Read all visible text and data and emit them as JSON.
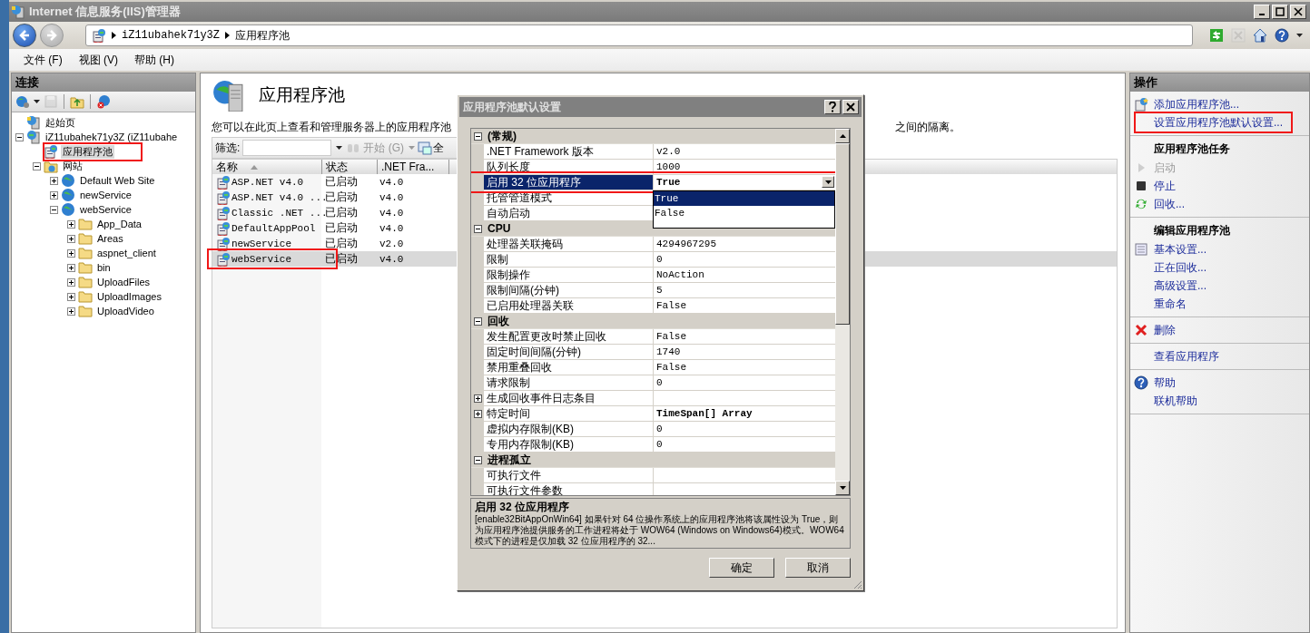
{
  "window": {
    "title": "Internet 信息服务(IIS)管理器"
  },
  "address_bar": {
    "back_enabled": true,
    "forward_enabled": false,
    "crumbs": [
      "iZ11ubahek71y3Z",
      "应用程序池"
    ]
  },
  "toolbar": [
    {
      "kind": "refresh",
      "disabled": false
    },
    {
      "kind": "stop",
      "disabled": true
    },
    {
      "kind": "home",
      "disabled": false
    },
    {
      "kind": "help",
      "disabled": false
    }
  ],
  "menu": [
    "文件 (F)",
    "视图 (V)",
    "帮助 (H)"
  ],
  "connections": {
    "title": "连接",
    "tools": [
      {
        "kind": "connect",
        "disabled": false
      },
      {
        "kind": "save",
        "disabled": true
      },
      {
        "kind": "up",
        "disabled": false
      },
      {
        "kind": "disconnect",
        "disabled": false
      }
    ],
    "tree": [
      {
        "label": "起始页",
        "kind": "start",
        "selected": false,
        "highlighted": false
      },
      {
        "label": "iZ11ubahek71y3Z (iZ11ubahe",
        "kind": "server",
        "expanded": true,
        "selected": false,
        "highlighted": false,
        "children": [
          {
            "label": "应用程序池",
            "kind": "pool",
            "selected": true,
            "highlighted": true
          },
          {
            "label": "网站",
            "kind": "sites",
            "expanded": true,
            "selected": false,
            "highlighted": false,
            "children": [
              {
                "label": "Default Web Site",
                "kind": "site",
                "expanded": false,
                "selected": false,
                "highlighted": false
              },
              {
                "label": "newService",
                "kind": "site",
                "expanded": false,
                "selected": false,
                "highlighted": false
              },
              {
                "label": "webService",
                "kind": "site",
                "expanded": true,
                "selected": false,
                "highlighted": false,
                "children": [
                  {
                    "label": "App_Data",
                    "kind": "folder",
                    "expanded": false,
                    "selected": false,
                    "highlighted": false
                  },
                  {
                    "label": "Areas",
                    "kind": "folder",
                    "expanded": false,
                    "selected": false,
                    "highlighted": false
                  },
                  {
                    "label": "aspnet_client",
                    "kind": "folder",
                    "expanded": false,
                    "selected": false,
                    "highlighted": false
                  },
                  {
                    "label": "bin",
                    "kind": "folder",
                    "expanded": false,
                    "selected": false,
                    "highlighted": false
                  },
                  {
                    "label": "UploadFiles",
                    "kind": "folder",
                    "expanded": false,
                    "selected": false,
                    "highlighted": false
                  },
                  {
                    "label": "UploadImages",
                    "kind": "folder",
                    "expanded": false,
                    "selected": false,
                    "highlighted": false
                  },
                  {
                    "label": "UploadVideo",
                    "kind": "folder",
                    "expanded": false,
                    "selected": false,
                    "highlighted": false
                  }
                ]
              }
            ]
          }
        ]
      }
    ]
  },
  "page": {
    "title": "应用程序池",
    "description": [
      "您可以在此页上查看和管理服务器上的应用程序池",
      "之间的隔离。"
    ],
    "filter": {
      "label": "筛选:",
      "go": "开始 (G)",
      "go_disabled": true,
      "show_all": "全"
    },
    "columns": [
      {
        "label": "名称",
        "sorted": true
      },
      {
        "label": "状态",
        "sorted": false
      },
      {
        "label": ".NET Fra...",
        "sorted": false
      }
    ],
    "rows": [
      {
        "cells": [
          "ASP.NET v4.0",
          "已启动",
          "v4.0"
        ],
        "selected": false,
        "highlighted": false
      },
      {
        "cells": [
          "ASP.NET v4.0 ...",
          "已启动",
          "v4.0"
        ],
        "selected": false,
        "highlighted": false
      },
      {
        "cells": [
          "Classic .NET ...",
          "已启动",
          "v4.0"
        ],
        "selected": false,
        "highlighted": false
      },
      {
        "cells": [
          "DefaultAppPool",
          "已启动",
          "v4.0"
        ],
        "selected": false,
        "highlighted": false
      },
      {
        "cells": [
          "newService",
          "已启动",
          "v2.0"
        ],
        "selected": false,
        "highlighted": false
      },
      {
        "cells": [
          "webService",
          "已启动",
          "v4.0"
        ],
        "selected": true,
        "highlighted": true
      }
    ]
  },
  "actions": {
    "title": "操作",
    "groups": [
      {
        "items": [
          {
            "label": "添加应用程序池...",
            "kind": "add",
            "disabled": false,
            "highlighted": false
          },
          {
            "label": "设置应用程序池默认设置...",
            "disabled": false,
            "highlighted": true
          }
        ]
      },
      {
        "heading": "应用程序池任务",
        "items": [
          {
            "label": "启动",
            "kind": "play",
            "disabled": true,
            "highlighted": false
          },
          {
            "label": "停止",
            "kind": "stop",
            "disabled": false,
            "highlighted": false
          },
          {
            "label": "回收...",
            "kind": "recycle",
            "disabled": false,
            "highlighted": false
          }
        ]
      },
      {
        "heading": "编辑应用程序池",
        "items": [
          {
            "label": "基本设置...",
            "kind": "basic",
            "disabled": false,
            "highlighted": false
          },
          {
            "label": "正在回收...",
            "disabled": false,
            "highlighted": false
          },
          {
            "label": "高级设置...",
            "disabled": false,
            "highlighted": false
          },
          {
            "label": "重命名",
            "disabled": false,
            "highlighted": false
          }
        ]
      },
      {
        "items": [
          {
            "label": "删除",
            "kind": "delete",
            "disabled": false,
            "highlighted": false
          }
        ]
      },
      {
        "items": [
          {
            "label": "查看应用程序",
            "disabled": false,
            "highlighted": false
          }
        ]
      },
      {
        "items": [
          {
            "label": "帮助",
            "kind": "help",
            "disabled": false,
            "highlighted": false
          },
          {
            "label": "联机帮助",
            "disabled": false,
            "highlighted": false
          }
        ]
      }
    ]
  },
  "dialog": {
    "title": "应用程序池默认设置",
    "categories": [
      {
        "label": "(常规)",
        "expanded": true,
        "properties": [
          {
            "name": ".NET Framework 版本",
            "value": "v2.0",
            "selected": false,
            "modified": false
          },
          {
            "name": "队列长度",
            "value": "1000",
            "selected": false,
            "modified": false
          },
          {
            "name": "启用 32 位应用程序",
            "value": "True",
            "selected": true,
            "modified": true,
            "highlighted": true,
            "options": [
              {
                "label": "True",
                "selected": true
              },
              {
                "label": "False",
                "selected": false
              }
            ]
          },
          {
            "name": "托管管道模式",
            "selected": false
          },
          {
            "name": "自动启动",
            "selected": false
          }
        ]
      },
      {
        "label": "CPU",
        "expanded": true,
        "properties": [
          {
            "name": "处理器关联掩码",
            "value": "4294967295",
            "selected": false,
            "modified": false
          },
          {
            "name": "限制",
            "value": "0",
            "selected": false,
            "modified": false
          },
          {
            "name": "限制操作",
            "value": "NoAction",
            "selected": false,
            "modified": false
          },
          {
            "name": "限制间隔(分钟)",
            "value": "5",
            "selected": false,
            "modified": false
          },
          {
            "name": "已启用处理器关联",
            "value": "False",
            "selected": false,
            "modified": false
          }
        ]
      },
      {
        "label": "回收",
        "expanded": true,
        "properties": [
          {
            "name": "发生配置更改时禁止回收",
            "value": "False",
            "selected": false,
            "modified": false
          },
          {
            "name": "固定时间间隔(分钟)",
            "value": "1740",
            "selected": false,
            "modified": false
          },
          {
            "name": "禁用重叠回收",
            "value": "False",
            "selected": false,
            "modified": false
          },
          {
            "name": "请求限制",
            "value": "0",
            "selected": false,
            "modified": false
          },
          {
            "name": "生成回收事件日志条目",
            "expanded": false,
            "selected": false
          },
          {
            "name": "特定时间",
            "value": "TimeSpan[] Array",
            "expanded": false,
            "selected": false,
            "modified": true
          },
          {
            "name": "虚拟内存限制(KB)",
            "value": "0",
            "selected": false,
            "modified": false
          },
          {
            "name": "专用内存限制(KB)",
            "value": "0",
            "selected": false,
            "modified": false
          }
        ]
      },
      {
        "label": "进程孤立",
        "expanded": true,
        "properties": [
          {
            "name": "可执行文件",
            "selected": false
          },
          {
            "name": "可执行文件参数",
            "selected": false
          }
        ]
      }
    ],
    "help_title": "启用 32 位应用程序",
    "help_text": "[enable32BitAppOnWin64] 如果针对 64 位操作系统上的应用程序池将该属性设为 True，则为应用程序池提供服务的工作进程将处于 WOW64 (Windows on Windows64)模式。WOW64 模式下的进程是仅加载 32 位应用程序的 32...",
    "buttons": [
      "确定",
      "取消"
    ]
  }
}
